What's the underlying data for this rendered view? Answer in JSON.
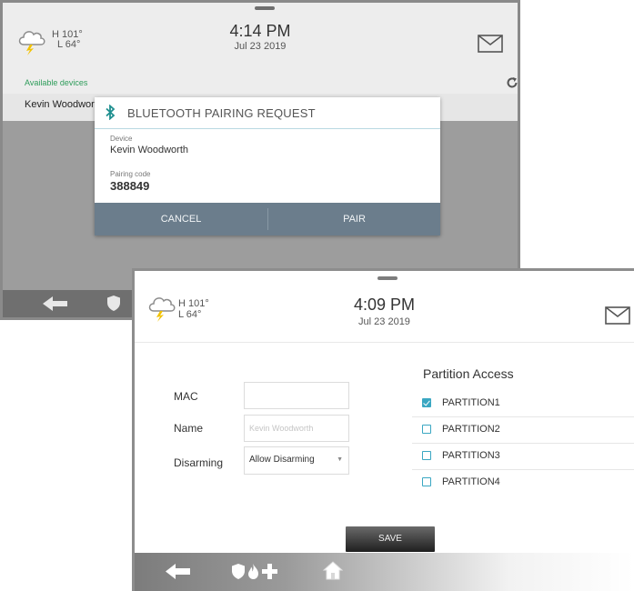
{
  "back_screen": {
    "weather": {
      "high": "H 101°",
      "low": "L 64°",
      "icon": "cloud-lightning-icon"
    },
    "time": "4:14 PM",
    "date": "Jul 23 2019",
    "available_devices_label": "Available devices",
    "device_item": "Kevin Woodworth",
    "dialog": {
      "title": "BLUETOOTH PAIRING REQUEST",
      "device_label": "Device",
      "device_value": "Kevin Woodworth",
      "code_label": "Pairing code",
      "code_value": "388849",
      "cancel_label": "CANCEL",
      "pair_label": "PAIR"
    }
  },
  "front_screen": {
    "weather": {
      "high": "H 101°",
      "low": "L 64°",
      "icon": "cloud-lightning-icon"
    },
    "time": "4:09 PM",
    "date": "Jul 23 2019",
    "form": {
      "mac_label": "MAC",
      "mac_value": "",
      "name_label": "Name",
      "name_placeholder": "Kevin Woodworth",
      "disarming_label": "Disarming",
      "disarming_value": "Allow Disarming"
    },
    "partition_access": {
      "title": "Partition Access",
      "items": [
        {
          "label": "PARTITION1",
          "checked": true
        },
        {
          "label": "PARTITION2",
          "checked": false
        },
        {
          "label": "PARTITION3",
          "checked": false
        },
        {
          "label": "PARTITION4",
          "checked": false
        }
      ]
    },
    "save_label": "SAVE"
  },
  "colors": {
    "accent": "#3aa7c2",
    "dialog_buttons": "#6b7d8c",
    "available_devices": "#2e9c5a",
    "bluetooth": "#1f8f8f"
  }
}
